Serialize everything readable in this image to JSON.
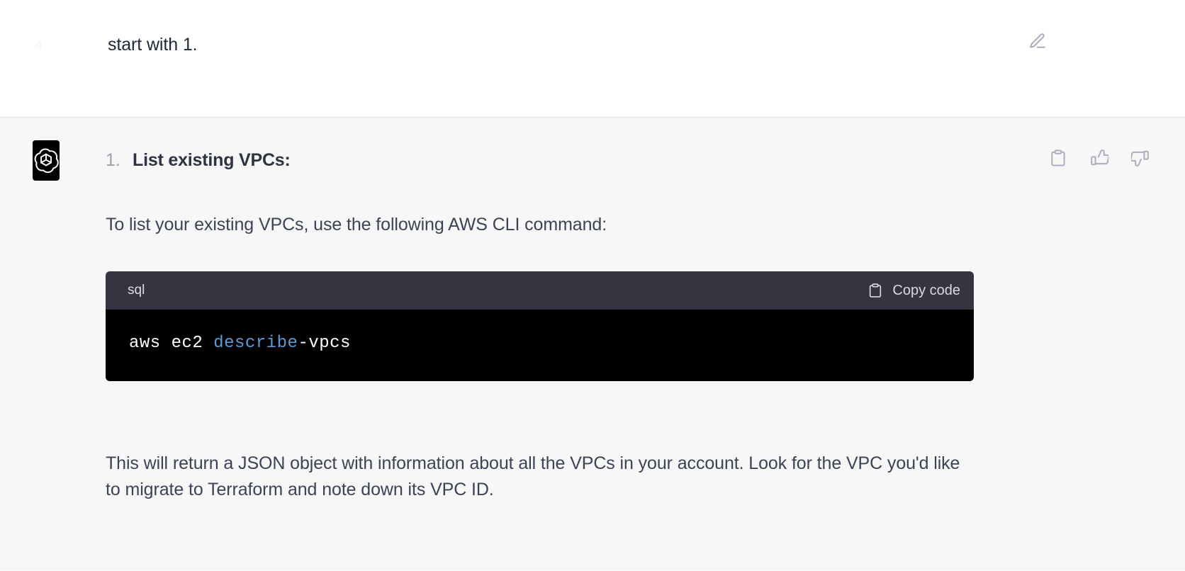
{
  "user_message": {
    "avatar_name": "user-head-profile-avatar",
    "text": "start with 1.",
    "edit_icon": "edit-pencil-square-icon"
  },
  "assistant_message": {
    "avatar_name": "openai-logo-avatar",
    "actions": [
      {
        "name": "copy-icon",
        "label": "Copy"
      },
      {
        "name": "thumbs-up-icon",
        "label": "Good response"
      },
      {
        "name": "thumbs-down-icon",
        "label": "Bad response"
      }
    ],
    "list_item": {
      "marker": "1.",
      "title": "List existing VPCs:"
    },
    "intro_paragraph": "To list your existing VPCs, use the following AWS CLI command:",
    "code_block": {
      "language": "sql",
      "copy_label": "Copy code",
      "copy_icon": "clipboard-icon",
      "code_prefix": "aws ec2 ",
      "code_keyword": "describe",
      "code_suffix": "-vpcs",
      "keyword_color": "#569cd6",
      "header_bg": "#343541",
      "body_bg": "#000000"
    },
    "outro_paragraph": "This will return a JSON object with information about all the VPCs in your account. Look for the VPC you'd like to migrate to Terraform and note down its VPC ID."
  },
  "theme": {
    "user_bg": "#ffffff",
    "assistant_bg": "#f7f7f8",
    "divider": "#e5e5e5",
    "text_primary": "#2d3340",
    "text_secondary": "#3c4354",
    "marker_gray": "#9aa0ac",
    "icon_gray": "#acacbe"
  }
}
